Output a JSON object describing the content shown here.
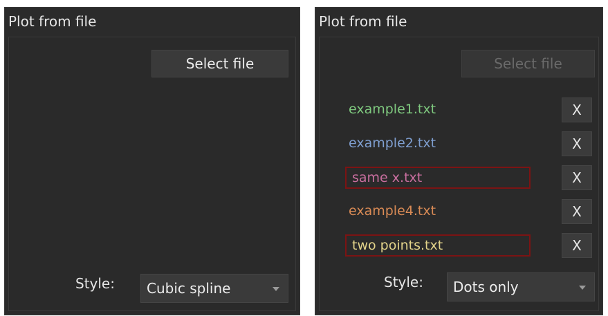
{
  "left_panel": {
    "title": "Plot from file",
    "select_button": "Select file",
    "style_label": "Style:",
    "style_value": "Cubic spline"
  },
  "right_panel": {
    "title": "Plot from file",
    "select_button": "Select file",
    "files": [
      {
        "name": "example1.txt",
        "color": "#7fc97f",
        "flagged": false
      },
      {
        "name": "example2.txt",
        "color": "#7f9fd0",
        "flagged": false
      },
      {
        "name": "same x.txt",
        "color": "#c86e9e",
        "flagged": true
      },
      {
        "name": "example4.txt",
        "color": "#d88a55",
        "flagged": false
      },
      {
        "name": "two points.txt",
        "color": "#e2d38a",
        "flagged": true
      }
    ],
    "remove_label": "X",
    "style_label": "Style:",
    "style_value": "Dots only"
  },
  "colors": {
    "panel_bg": "#2b2b2b",
    "flag_border": "#7c1313"
  }
}
